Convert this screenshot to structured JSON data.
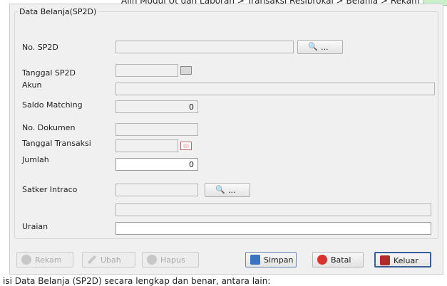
{
  "doc": {
    "top_line": "Alih Modul Ut dan Laporan  >  Transaksi Resiprokal  >  Belanja  >  Rekam",
    "bottom_line": "isi Data Belanja (SP2D) secara lengkap dan benar, antara lain:"
  },
  "form": {
    "group_title": "Data Belanja(SP2D)",
    "labels": {
      "no_sp2d": "No. SP2D",
      "tanggal_sp2d": "Tanggal SP2D",
      "akun": "Akun",
      "saldo_matching": "Saldo Matching",
      "no_dokumen": "No. Dokumen",
      "tanggal_transaksi": "Tanggal Transaksi",
      "jumlah": "Jumlah",
      "satker_intraco": "Satker Intraco",
      "uraian": "Uraian"
    },
    "values": {
      "saldo_matching": "0",
      "jumlah": "0"
    },
    "lookup_dots": "..."
  },
  "buttons": {
    "rekam": "Rekam",
    "ubah": "Ubah",
    "hapus": "Hapus",
    "simpan": "Simpan",
    "batal": "Batal",
    "keluar": "Keluar"
  },
  "colors": {
    "window_bg": "#f0f0f0",
    "batal_icon": "#d9342b",
    "simpan_icon": "#3a73c4",
    "keluar_icon": "#b22b2b",
    "disabled": "#c7c7c7"
  },
  "icons": {
    "lookup": "magnifier-icon",
    "calendar": "calendar-icon",
    "rekam": "circle-plus-icon",
    "ubah": "pencil-icon",
    "hapus": "circle-minus-icon",
    "simpan": "floppy-icon",
    "batal": "x-circle-icon",
    "keluar": "exit-door-icon"
  }
}
